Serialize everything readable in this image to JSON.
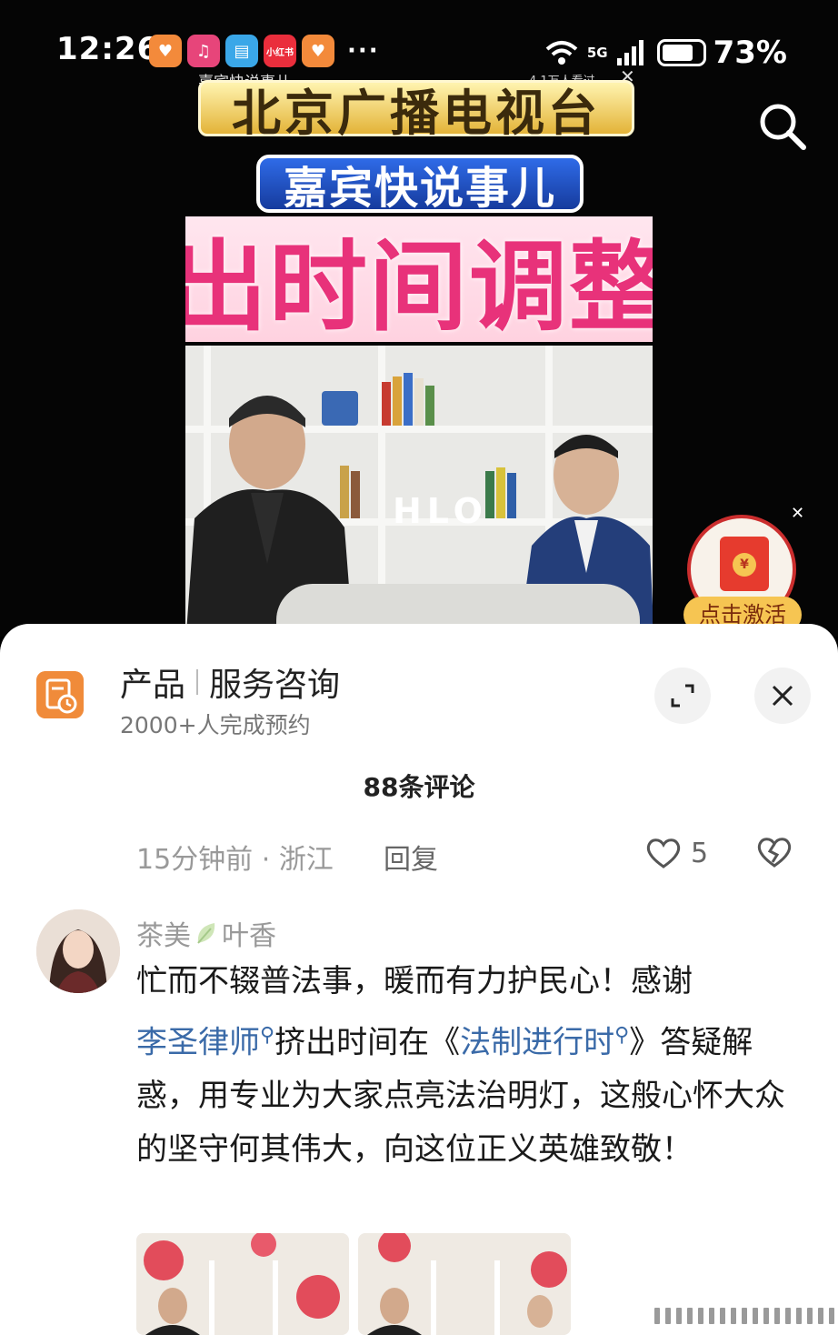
{
  "status_bar": {
    "time": "12:26",
    "more": "···",
    "network": "5G",
    "battery": "73%",
    "battery_level": 0.73,
    "apps": [
      {
        "icon": "heart-app-icon",
        "color": "#f38a3b",
        "glyph": "♥"
      },
      {
        "icon": "music-app-icon",
        "color": "#e7457a",
        "glyph": "♫"
      },
      {
        "icon": "book-app-icon",
        "color": "#3aa7e8",
        "glyph": "▤"
      },
      {
        "icon": "xiaohongshu-app-icon",
        "color": "#ea2e3c",
        "glyph": "小红书"
      },
      {
        "icon": "heart-app-icon-2",
        "color": "#f38a3b",
        "glyph": "♥"
      }
    ]
  },
  "video": {
    "mini_title": "嘉宾快说事儿",
    "mini_watchers": "4.1万人看过",
    "station": "北京广播电视台",
    "show_name": "嘉宾快说事儿",
    "banner_text": "出时间调整",
    "studio_logo": "HLO",
    "redpacket_label": "点击激活",
    "redpacket_coin": "¥"
  },
  "ad": {
    "title_part1": "产品",
    "title_part2": "服务咨询",
    "subtitle": "2000+人完成预约",
    "icon": "booking-icon"
  },
  "comments": {
    "count_label": "88条评论",
    "prev": {
      "time": "15分钟前",
      "location": "浙江",
      "reply_label": "回复",
      "likes": "5"
    },
    "item": {
      "username_a": "茶美",
      "username_b": "叶香",
      "line1": "忙而不辍普法事，暖而有力护民心！感谢",
      "link1": "李圣律师",
      "mid1": "挤出时间在《",
      "link2": "法制进行时",
      "mid2": "》答疑解惑，用专业为大家点亮法治明灯，这般心怀大众的坚守何其伟大，向这位正义英雄致敬！"
    }
  },
  "colors": {
    "accent_link": "#3a6aa8",
    "ad_orange": "#f08b3a",
    "banner_pink": "#e8327a"
  }
}
